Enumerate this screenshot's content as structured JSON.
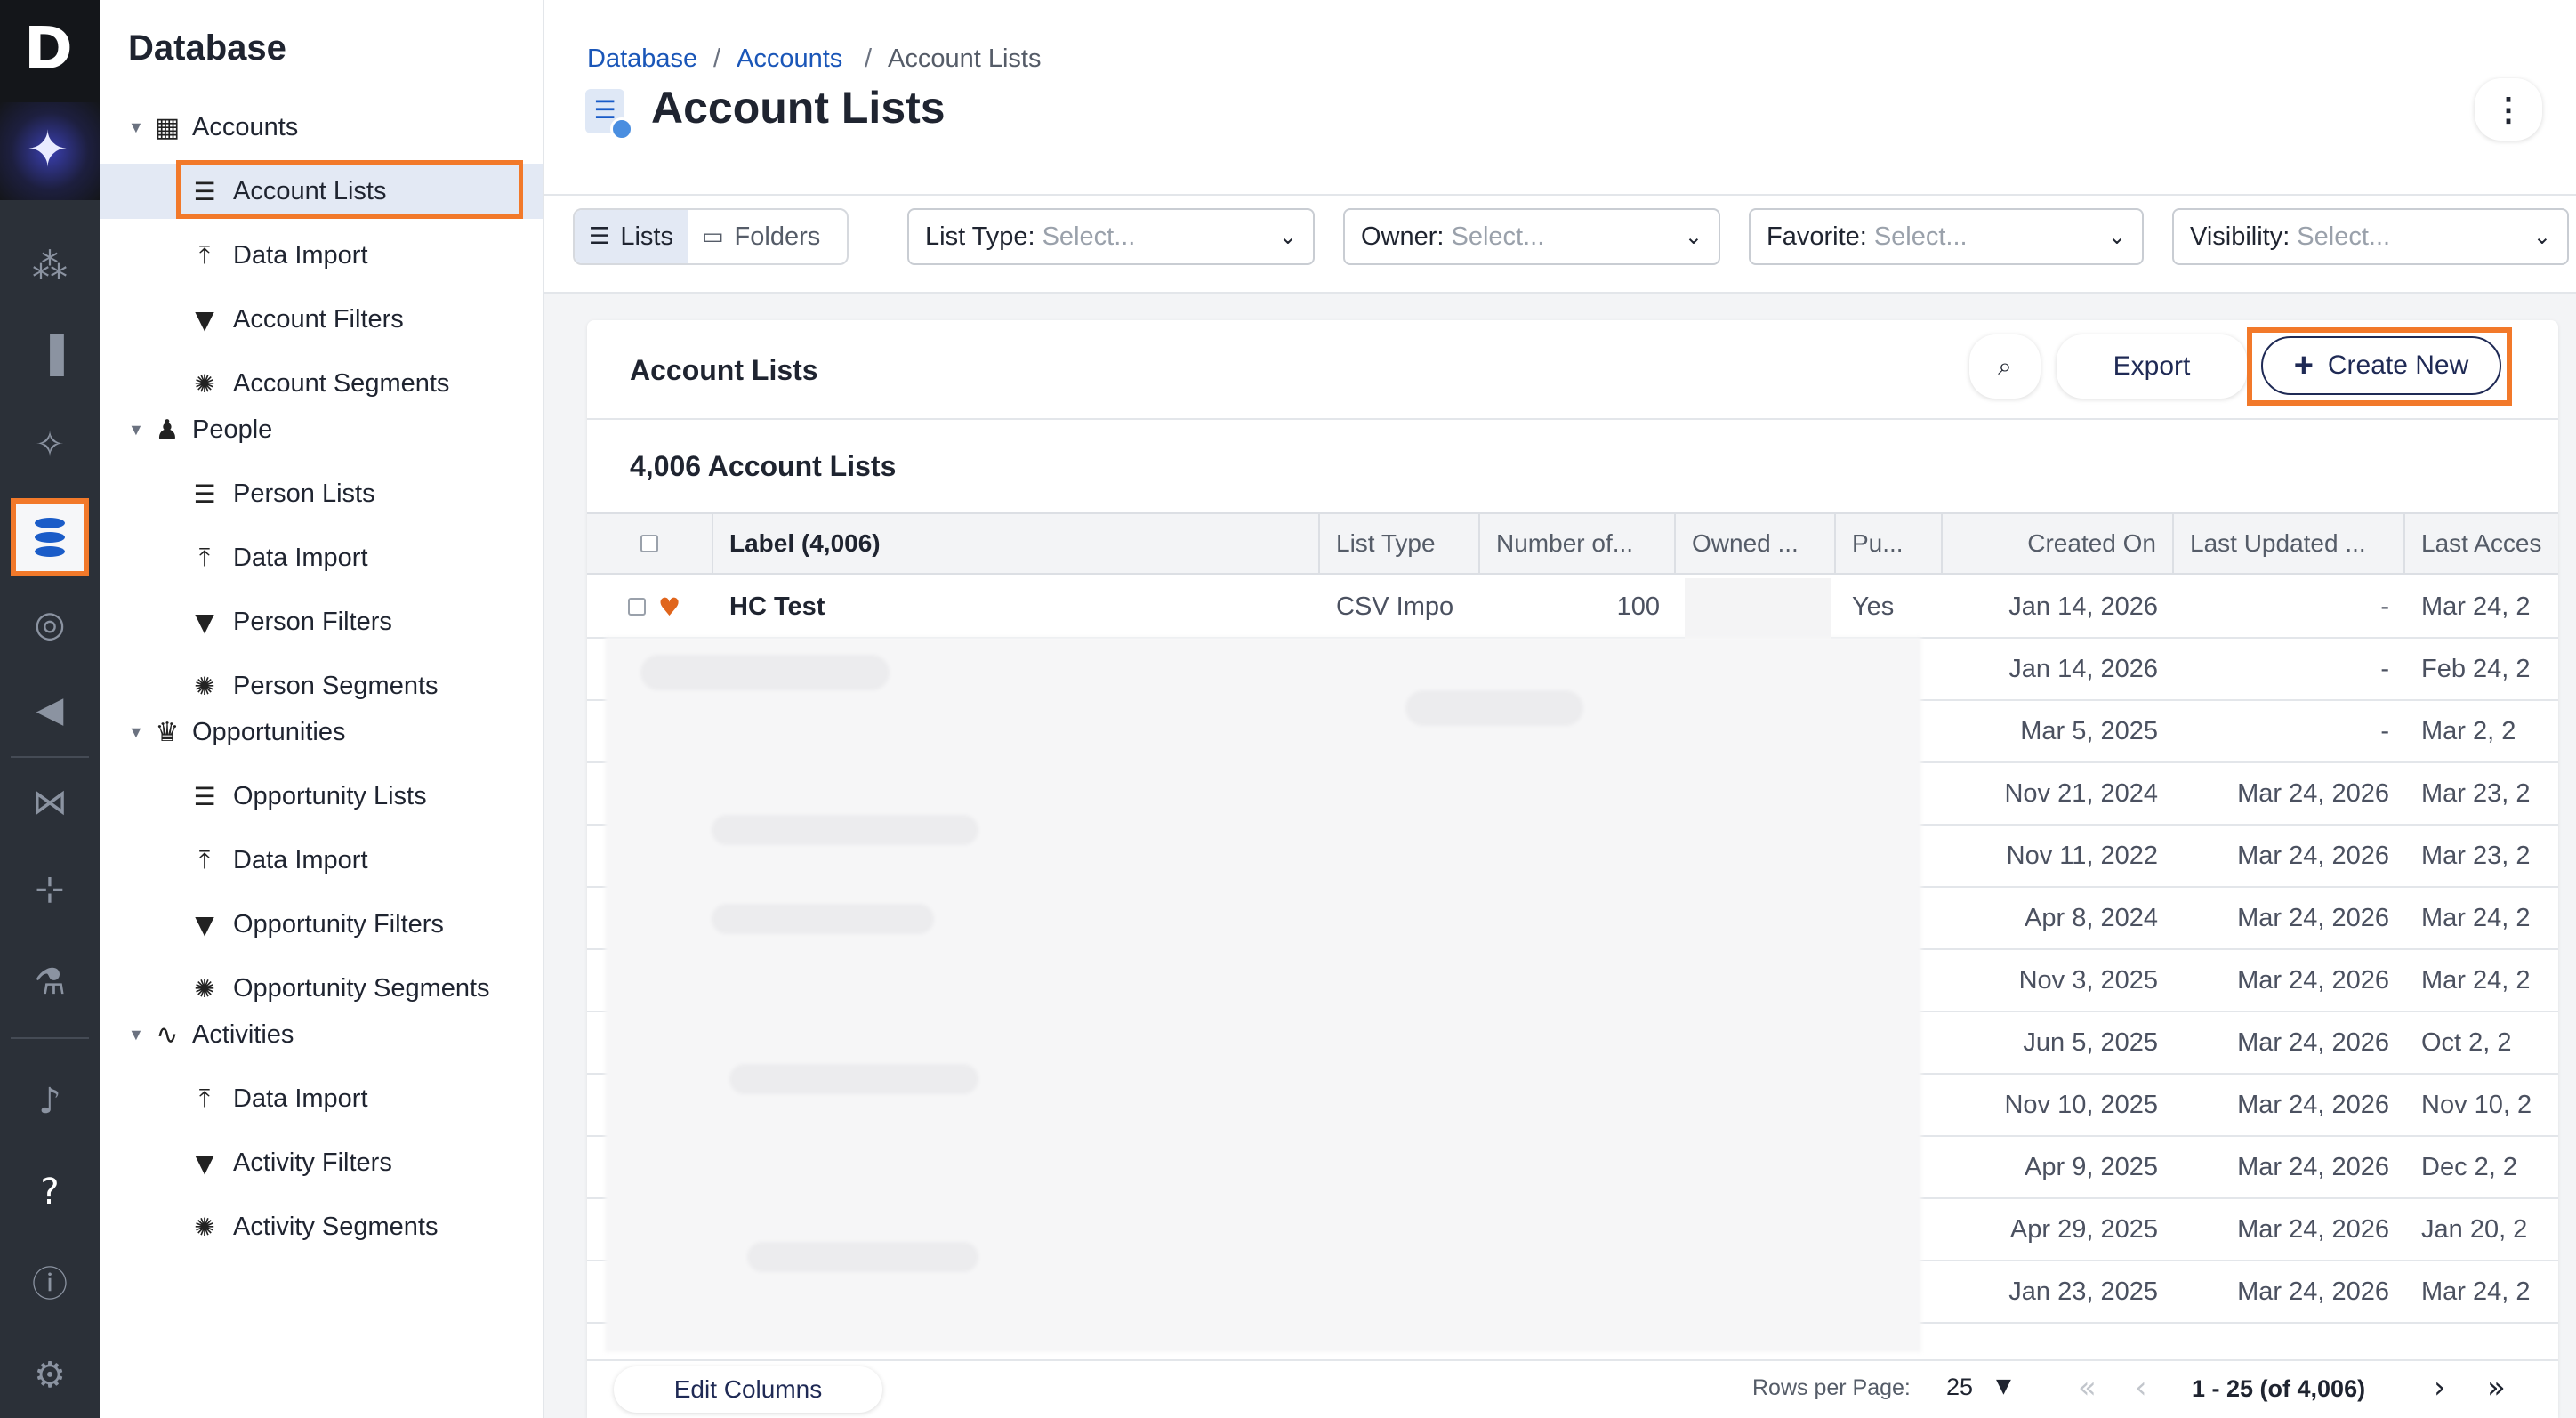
{
  "app": {
    "logo_letter": "D",
    "rail_icons": [
      "sparkle-icon",
      "people-icon",
      "chart-icon",
      "wand-icon",
      "database-icon",
      "target-icon",
      "megaphone-icon",
      "handshake-icon",
      "network-icon",
      "flask-icon",
      "bell-icon",
      "help-icon",
      "info-icon",
      "gear-icon"
    ],
    "accent_color": "#f2792a",
    "link_color": "#1a56b8"
  },
  "sidebar": {
    "title": "Database",
    "groups": [
      {
        "label": "Accounts",
        "items": [
          {
            "label": "Account Lists"
          },
          {
            "label": "Data Import"
          },
          {
            "label": "Account Filters"
          },
          {
            "label": "Account Segments"
          }
        ]
      },
      {
        "label": "People",
        "items": [
          {
            "label": "Person Lists"
          },
          {
            "label": "Data Import"
          },
          {
            "label": "Person Filters"
          },
          {
            "label": "Person Segments"
          }
        ]
      },
      {
        "label": "Opportunities",
        "items": [
          {
            "label": "Opportunity Lists"
          },
          {
            "label": "Data Import"
          },
          {
            "label": "Opportunity Filters"
          },
          {
            "label": "Opportunity Segments"
          }
        ]
      },
      {
        "label": "Activities",
        "items": [
          {
            "label": "Data Import"
          },
          {
            "label": "Activity Filters"
          },
          {
            "label": "Activity Segments"
          }
        ]
      }
    ]
  },
  "header": {
    "breadcrumb": [
      "Database",
      "Accounts",
      "Account Lists"
    ],
    "breadcrumb_sep": "/",
    "title": "Account Lists"
  },
  "toolbar": {
    "view_toggle": [
      {
        "label": "Lists",
        "active": true
      },
      {
        "label": "Folders",
        "active": false
      }
    ],
    "filters": [
      {
        "label": "List Type:",
        "placeholder": "Select..."
      },
      {
        "label": "Owner:",
        "placeholder": "Select..."
      },
      {
        "label": "Favorite:",
        "placeholder": "Select..."
      },
      {
        "label": "Visibility:",
        "placeholder": "Select..."
      }
    ]
  },
  "card": {
    "title": "Account Lists",
    "export_label": "Export",
    "create_label": "Create New",
    "count_label": "4,006 Account Lists"
  },
  "table": {
    "columns": [
      "Label (4,006)",
      "List Type",
      "Number of...",
      "Owned ...",
      "Pu...",
      "Created On",
      "Last Updated ...",
      "Last Acces"
    ],
    "rows": [
      {
        "label": "HC Test",
        "list_type": "CSV Impo",
        "number": "100",
        "public": "Yes",
        "created": "Jan 14, 2026",
        "updated": "-",
        "accessed": "Mar 24, 2",
        "favorite": true
      },
      {
        "created": "Jan 14, 2026",
        "updated": "-",
        "accessed": "Feb 24, 2"
      },
      {
        "created": "Mar 5, 2025",
        "updated": "-",
        "accessed": "Mar 2, 2"
      },
      {
        "created": "Nov 21, 2024",
        "updated": "Mar 24, 2026",
        "accessed": "Mar 23, 2"
      },
      {
        "created": "Nov 11, 2022",
        "updated": "Mar 24, 2026",
        "accessed": "Mar 23, 2"
      },
      {
        "created": "Apr 8, 2024",
        "updated": "Mar 24, 2026",
        "accessed": "Mar 24, 2"
      },
      {
        "created": "Nov 3, 2025",
        "updated": "Mar 24, 2026",
        "accessed": "Mar 24, 2"
      },
      {
        "created": "Jun 5, 2025",
        "updated": "Mar 24, 2026",
        "accessed": "Oct 2, 2"
      },
      {
        "created": "Nov 10, 2025",
        "updated": "Mar 24, 2026",
        "accessed": "Nov 10, 2"
      },
      {
        "created": "Apr 9, 2025",
        "updated": "Mar 24, 2026",
        "accessed": "Dec 2, 2"
      },
      {
        "created": "Apr 29, 2025",
        "updated": "Mar 24, 2026",
        "accessed": "Jan 20, 2"
      },
      {
        "created": "Jan 23, 2025",
        "updated": "Mar 24, 2026",
        "accessed": "Mar 24, 2"
      }
    ]
  },
  "footer": {
    "edit_columns_label": "Edit Columns",
    "rows_per_page_label": "Rows per Page:",
    "rows_per_page_value": "25",
    "range_label": "1 - 25 (of 4,006)"
  }
}
